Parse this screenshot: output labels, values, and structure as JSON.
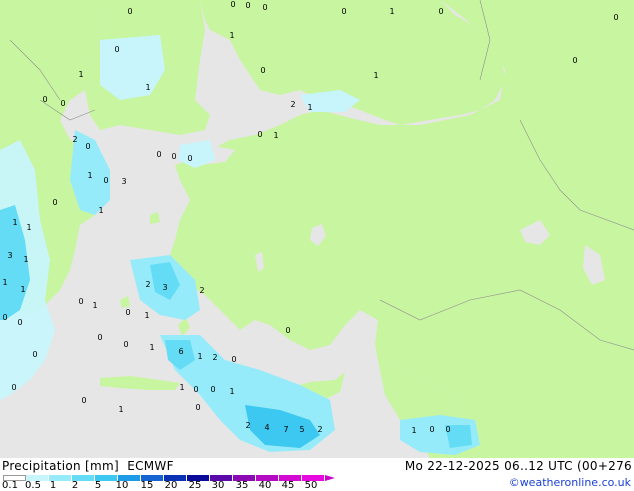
{
  "product": {
    "left_title": "Precipitation [mm]  ECMWF",
    "right_title": "Mo 22-12-2025 06..12 UTC (00+276",
    "credit": "©weatheronline.co.uk"
  },
  "legend": {
    "ticks": [
      "0.1",
      "0.5",
      "1",
      "2",
      "5",
      "10",
      "15",
      "20",
      "25",
      "30",
      "35",
      "40",
      "45",
      "50"
    ],
    "colors": [
      "#ffffff",
      "#c8f5fc",
      "#96ebfa",
      "#64dcf5",
      "#3cc8f0",
      "#1e9be6",
      "#1464d2",
      "#0a32b4",
      "#0a0a9b",
      "#5a0aaa",
      "#8c0ab4",
      "#b40ac3",
      "#d20ad2",
      "#e60ae1"
    ]
  },
  "map_colors": {
    "sea": "#e6e6e6",
    "land": "#c8f5a0",
    "precip_light": "#c8f5fc",
    "precip_moderate": "#96ebfa",
    "precip_heavy": "#64dcf5",
    "precip_strong": "#3cc8f0"
  },
  "point_values": [
    "0",
    "0",
    "0",
    "0",
    "1",
    "0",
    "0",
    "1",
    "0",
    "0",
    "1",
    "1",
    "0",
    "0",
    "0",
    "1",
    "0",
    "2",
    "1",
    "0",
    "1",
    "0",
    "0",
    "0",
    "2",
    "0",
    "1",
    "0",
    "3",
    "1",
    "1",
    "1",
    "3",
    "1",
    "1",
    "1",
    "0",
    "2",
    "3",
    "2",
    "0",
    "1",
    "0",
    "1",
    "0",
    "0",
    "6",
    "1",
    "2",
    "0",
    "0",
    "0",
    "1",
    "0",
    "1",
    "0",
    "0",
    "1",
    "2",
    "4",
    "7",
    "5",
    "2",
    "0",
    "0",
    "1",
    "0",
    "1",
    "0",
    "0",
    "0"
  ]
}
